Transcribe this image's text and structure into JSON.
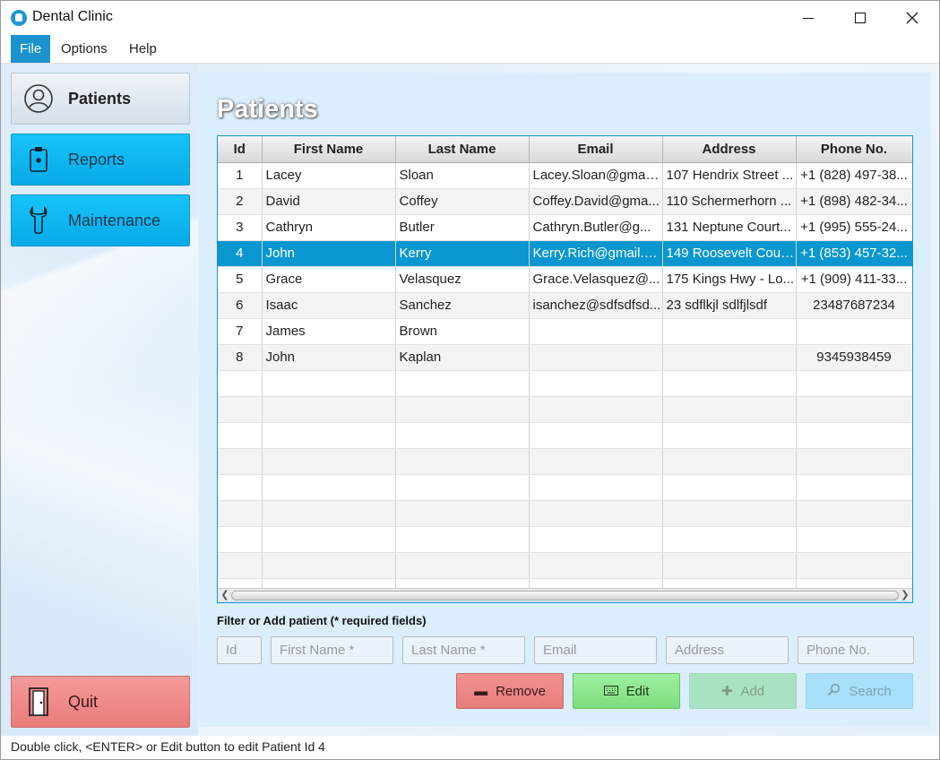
{
  "window": {
    "title": "Dental Clinic"
  },
  "menu": {
    "items": [
      {
        "label": "File",
        "active": true
      },
      {
        "label": "Options",
        "active": false
      },
      {
        "label": "Help",
        "active": false
      }
    ]
  },
  "sidebar": {
    "items": [
      {
        "label": "Patients",
        "icon": "user-circle-icon",
        "selected": true
      },
      {
        "label": "Reports",
        "icon": "clipboard-icon",
        "selected": false
      },
      {
        "label": "Maintenance",
        "icon": "wrench-icon",
        "selected": false
      }
    ],
    "quit_label": "Quit",
    "quit_icon": "door-icon"
  },
  "main": {
    "title": "Patients",
    "table": {
      "columns": [
        "Id",
        "First Name",
        "Last Name",
        "Email",
        "Address",
        "Phone No."
      ],
      "rows": [
        [
          "1",
          "Lacey",
          "Sloan",
          "Lacey.Sloan@gmail...",
          "107 Hendrix Street ...",
          "+1 (828) 497-38..."
        ],
        [
          "2",
          "David",
          "Coffey",
          "Coffey.David@gma...",
          "110 Schermerhorn ...",
          "+1 (898) 482-34..."
        ],
        [
          "3",
          "Cathryn",
          "Butler",
          "Cathryn.Butler@g...",
          "131 Neptune Court...",
          "+1 (995) 555-24..."
        ],
        [
          "4",
          "John",
          "Kerry",
          "Kerry.Rich@gmail.c...",
          "149 Roosevelt Cour...",
          "+1 (853) 457-32..."
        ],
        [
          "5",
          "Grace",
          "Velasquez",
          "Grace.Velasquez@...",
          "175 Kings Hwy - Lo...",
          "+1 (909) 411-33..."
        ],
        [
          "6",
          "Isaac",
          "Sanchez",
          "isanchez@sdfsdfsd...",
          "23 sdflkjl sdlfjlsdf",
          "23487687234"
        ],
        [
          "7",
          "James",
          "Brown",
          "",
          "",
          ""
        ],
        [
          "8",
          "John",
          "Kaplan",
          "",
          "",
          "9345938459"
        ]
      ],
      "selected_row_index": 3,
      "empty_rows": 9
    },
    "filter": {
      "label": "Filter or Add patient (* required fields)",
      "placeholders": {
        "id": "Id",
        "first_name": "First Name *",
        "last_name": "Last Name *",
        "email": "Email",
        "address": "Address",
        "phone": "Phone No."
      }
    },
    "buttons": {
      "remove": "Remove",
      "edit": "Edit",
      "add": "Add",
      "search": "Search"
    }
  },
  "status": {
    "text": "Double click, <ENTER> or Edit button to edit Patient Id 4"
  },
  "colors": {
    "accent": "#1a93cf",
    "selected_row": "#0a97cf",
    "sidebar_button": "#08a9e8",
    "quit": "#e97b7b",
    "remove": "#e77d7d",
    "edit": "#7fdc7f",
    "panel": "#dbeefc"
  }
}
